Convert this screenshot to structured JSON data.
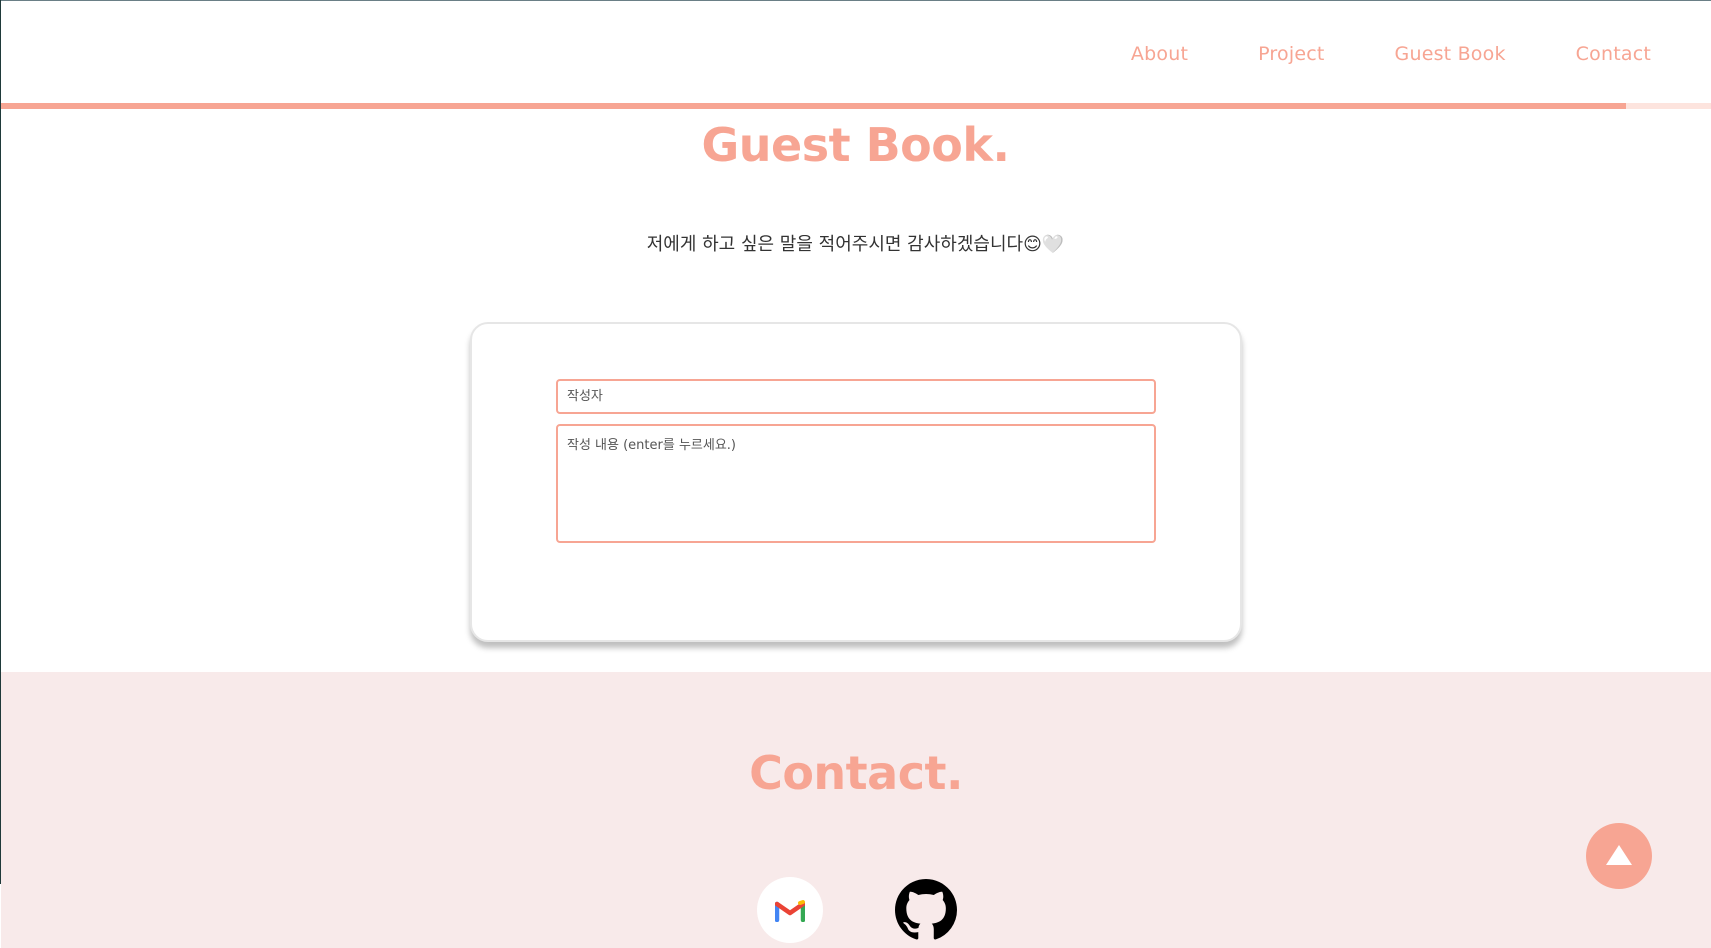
{
  "nav": {
    "links": [
      "About",
      "Project",
      "Guest Book",
      "Contact"
    ]
  },
  "scroll_progress_percent": 95,
  "guestbook": {
    "title": "Guest Book.",
    "subtitle": "저에게 하고 싶은 말을 적어주시면 감사하겠습니다😊🤍",
    "author_placeholder": "작성자",
    "content_placeholder": "작성 내용 (enter를 누르세요.)"
  },
  "contact": {
    "title": "Contact.",
    "icons": [
      "gmail-icon",
      "github-icon"
    ]
  },
  "scroll_top_icon": "triangle-up-icon",
  "colors": {
    "accent": "#f7a593",
    "contact_bg": "#f8eaea",
    "progress_track": "#fde4de"
  }
}
